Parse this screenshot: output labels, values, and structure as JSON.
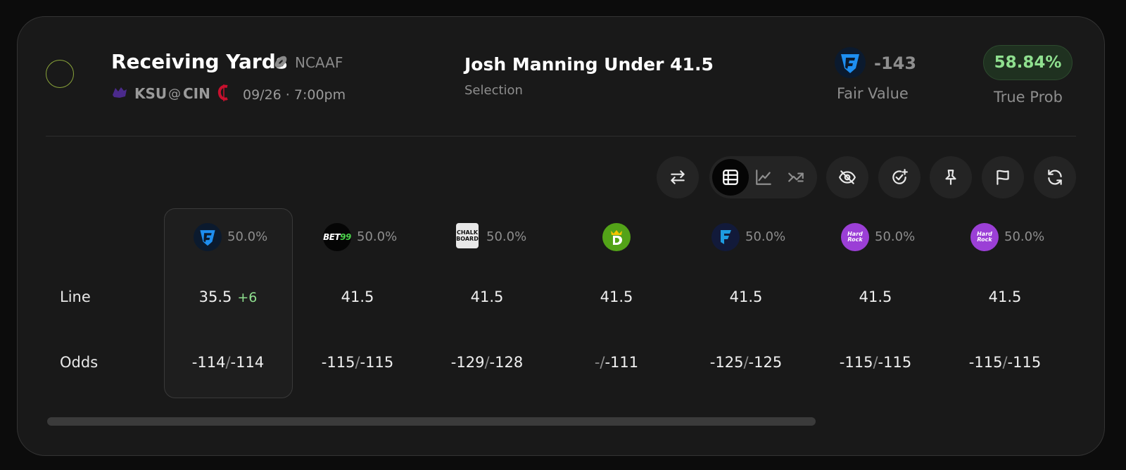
{
  "header": {
    "market": "Receiving Yards",
    "league": "NCAAF",
    "away_team": "KSU",
    "at": "@",
    "home_team": "CIN",
    "game_time": "09/26 · 7:00pm",
    "selection": "Josh Manning Under 41.5",
    "selection_label": "Selection",
    "fair_value_odds": "-143",
    "fair_value_label": "Fair Value",
    "true_prob": "58.84%",
    "true_prob_label": "True Prob"
  },
  "toolbar": {
    "icons": [
      "swap-icon",
      "table-view-icon",
      "line-chart-icon",
      "trend-chart-icon",
      "hide-icon",
      "check-add-icon",
      "pin-icon",
      "flag-icon",
      "refresh-icon"
    ],
    "active_view": "table"
  },
  "table": {
    "row_labels": {
      "line": "Line",
      "odds": "Odds"
    },
    "books": [
      {
        "name": "FanDuel",
        "pct": "50.0%",
        "line": "35.5",
        "line_diff": "+6",
        "odds_over": "-114",
        "odds_under": "-114",
        "highlighted": true
      },
      {
        "name": "BET99",
        "pct": "50.0%",
        "line": "41.5",
        "line_diff": "",
        "odds_over": "-115",
        "odds_under": "-115"
      },
      {
        "name": "Chalkboard",
        "pct": "50.0%",
        "line": "41.5",
        "line_diff": "",
        "odds_over": "-129",
        "odds_under": "-128"
      },
      {
        "name": "DraftKings",
        "pct": "",
        "line": "41.5",
        "line_diff": "",
        "odds_over": "-",
        "odds_under": "-111"
      },
      {
        "name": "Fanatics",
        "pct": "50.0%",
        "line": "41.5",
        "line_diff": "",
        "odds_over": "-125",
        "odds_under": "-125"
      },
      {
        "name": "Hard Rock",
        "pct": "50.0%",
        "line": "41.5",
        "line_diff": "",
        "odds_over": "-115",
        "odds_under": "-115"
      },
      {
        "name": "Hard Rock",
        "pct": "50.0%",
        "line": "41.5",
        "line_diff": "",
        "odds_over": "-115",
        "odds_under": "-115"
      }
    ],
    "slash": "/"
  },
  "colors": {
    "background": "#0c0c0c",
    "card": "#191919",
    "positive": "#8fe08f",
    "muted": "#8e8e8e"
  }
}
